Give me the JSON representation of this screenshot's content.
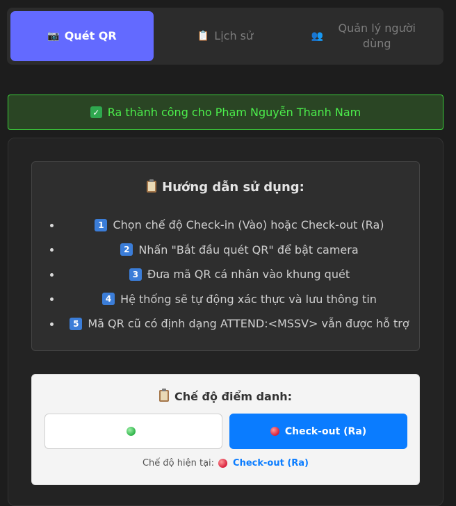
{
  "tabs": [
    {
      "label": "Quét QR",
      "icon": "camera-icon",
      "active": true
    },
    {
      "label": "Lịch sử",
      "icon": "clipboard-icon",
      "active": false
    },
    {
      "label": "Quản lý người dùng",
      "icon": "people-icon",
      "active": false
    }
  ],
  "alert": {
    "text": "Ra thành công cho Phạm Nguyễn Thanh Nam",
    "icon": "check-icon"
  },
  "guide": {
    "title": "Hướng dẫn sử dụng:",
    "steps": [
      {
        "num": "1",
        "text": "Chọn chế độ Check-in (Vào) hoặc Check-out (Ra)"
      },
      {
        "num": "2",
        "text": "Nhấn \"Bắt đầu quét QR\" để bật camera"
      },
      {
        "num": "3",
        "text": "Đưa mã QR cá nhân vào khung quét"
      },
      {
        "num": "4",
        "text": "Hệ thống sẽ tự động xác thực và lưu thông tin"
      },
      {
        "num": "5",
        "text": "Mã QR cũ có định dạng ATTEND:<MSSV> vẫn được hỗ trợ"
      }
    ]
  },
  "mode": {
    "title": "Chế độ điểm danh:",
    "checkin_label": "",
    "checkout_label": "Check-out (Ra)",
    "current_prefix": "Chế độ hiện tại:",
    "current_value": "Check-out (Ra)"
  },
  "colors": {
    "accent": "#636aff",
    "success": "#3bd13b",
    "primary_blue": "#0a7cff"
  }
}
